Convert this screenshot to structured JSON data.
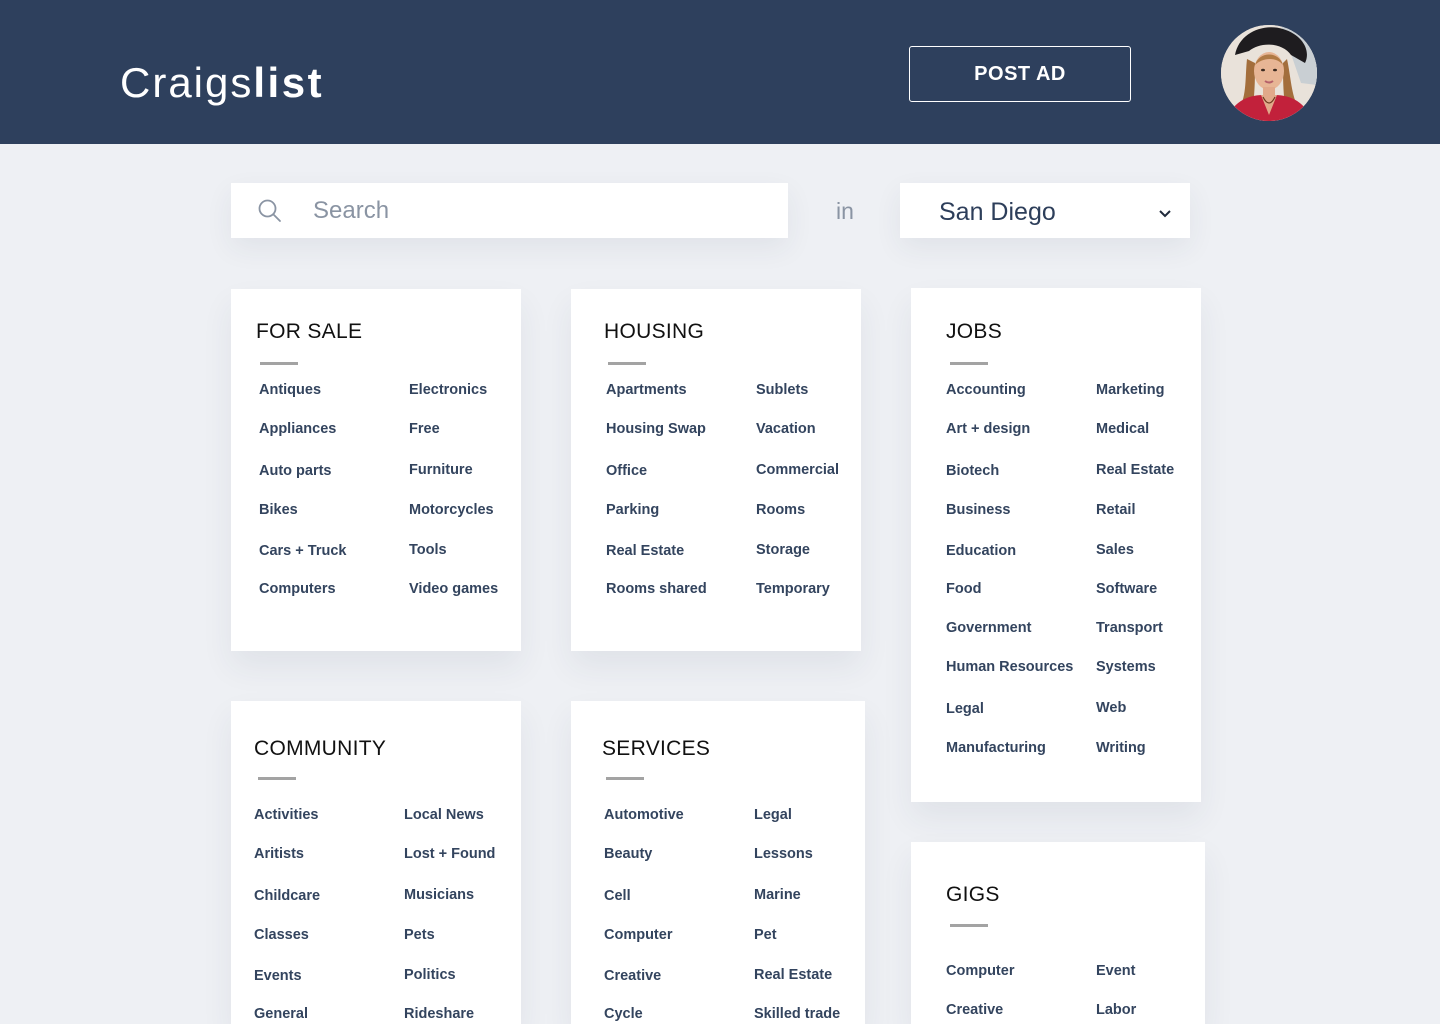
{
  "header": {
    "logo_light": "Craigs",
    "logo_bold": "list",
    "post_ad_label": "POST AD"
  },
  "search": {
    "placeholder": "Search",
    "value": "",
    "in_label": "in",
    "city": "San Diego"
  },
  "colors": {
    "header_bg": "#2e405d",
    "page_bg": "#eef0f4",
    "link": "#33445e"
  },
  "icons": [
    "search-icon",
    "chevron-down-icon"
  ],
  "sections": {
    "for_sale": {
      "title": "FOR SALE",
      "col1": [
        "Antiques",
        "Appliances",
        "Auto parts",
        "Bikes",
        "Cars + Truck",
        "Computers"
      ],
      "col2": [
        "Electronics",
        "Free",
        "Furniture",
        "Motorcycles",
        "Tools",
        "Video games"
      ]
    },
    "housing": {
      "title": "HOUSING",
      "col1": [
        "Apartments",
        "Housing Swap",
        "Office",
        "Parking",
        "Real Estate",
        "Rooms shared"
      ],
      "col2": [
        "Sublets",
        "Vacation",
        "Commercial",
        "Rooms",
        "Storage",
        "Temporary"
      ]
    },
    "jobs": {
      "title": "JOBS",
      "col1": [
        "Accounting",
        "Art + design",
        "Biotech",
        "Business",
        "Education",
        "Food",
        "Government",
        "Human Resources",
        "Legal",
        "Manufacturing"
      ],
      "col2": [
        "Marketing",
        "Medical",
        "Real Estate",
        "Retail",
        "Sales",
        "Software",
        "Transport",
        "Systems",
        "Web",
        "Writing"
      ]
    },
    "community": {
      "title": "COMMUNITY",
      "col1": [
        "Activities",
        "Aritists",
        "Childcare",
        "Classes",
        "Events",
        "General"
      ],
      "col2": [
        "Local News",
        "Lost + Found",
        "Musicians",
        "Pets",
        "Politics",
        "Rideshare"
      ]
    },
    "services": {
      "title": "SERVICES",
      "col1": [
        "Automotive",
        "Beauty",
        "Cell",
        "Computer",
        "Creative",
        "Cycle"
      ],
      "col2": [
        "Legal",
        "Lessons",
        "Marine",
        "Pet",
        "Real Estate",
        "Skilled trade"
      ]
    },
    "gigs": {
      "title": "GIGS",
      "col1": [
        "Computer",
        "Creative"
      ],
      "col2": [
        "Event",
        "Labor"
      ]
    }
  }
}
